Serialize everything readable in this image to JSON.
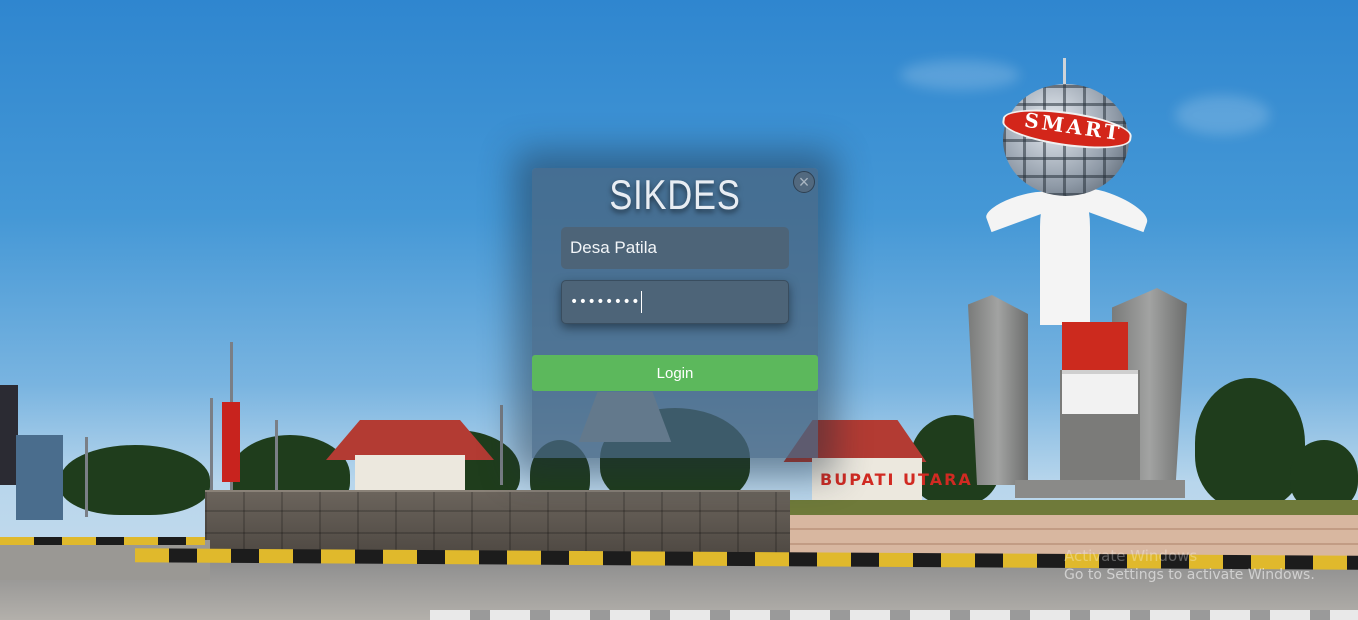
{
  "login": {
    "title": "SIKDES",
    "close_symbol": "×",
    "username_value": "Desa Patila",
    "password_mask": "••••••••",
    "login_label": "Login"
  },
  "background": {
    "monument_band_text": "SMART",
    "sign_text": "BUPATI UTARA"
  },
  "watermark": {
    "title": "Activate Windows",
    "subtitle": "Go to Settings to activate Windows."
  },
  "colors": {
    "login_button": "#5cb85c",
    "modal_bg": "#46647f",
    "field_bg": "#4d6478"
  },
  "icons": {
    "close": "close-icon"
  }
}
